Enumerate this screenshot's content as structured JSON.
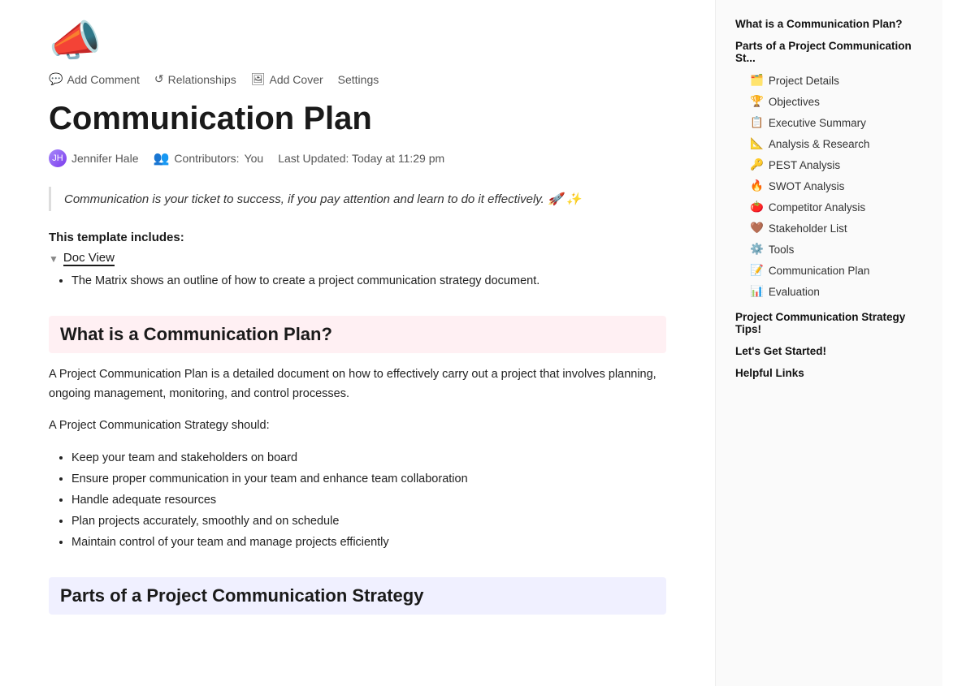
{
  "toolbar": {
    "add_comment_label": "Add Comment",
    "relationships_label": "Relationships",
    "add_cover_label": "Add Cover",
    "settings_label": "Settings"
  },
  "page": {
    "icon": "📣",
    "title": "Communication Plan",
    "author": "Jennifer Hale",
    "contributors_label": "Contributors:",
    "contributors_value": "You",
    "last_updated_label": "Last Updated:",
    "last_updated_value": "Today at 11:29 pm",
    "quote": "Communication is your ticket to success, if you pay attention and learn to do it effectively. 🚀 ✨",
    "template_includes_label": "This template includes:",
    "toggle_label": "Doc View",
    "bullet_text": "The Matrix shows an outline of how to create a project communication strategy document."
  },
  "sections": [
    {
      "id": "what-is",
      "heading": "What is a Communication Plan?",
      "style": "pink",
      "body": "A Project Communication Plan is a detailed document on how to effectively carry out a project that involves planning, ongoing management, monitoring, and control processes.",
      "subtext": "A Project Communication Strategy should:",
      "bullets": [
        "Keep your team and stakeholders on board",
        "Ensure proper communication in your team and enhance team collaboration",
        "Handle adequate resources",
        "Plan projects accurately, smoothly and on schedule",
        "Maintain control of your team and manage projects efficiently"
      ]
    },
    {
      "id": "parts-of",
      "heading": "Parts of a Project Communication Strategy",
      "style": "lavender",
      "body": "",
      "subtext": "",
      "bullets": []
    }
  ],
  "sidebar": {
    "items_main": [
      {
        "label": "What is a Communication Plan?",
        "emoji": ""
      },
      {
        "label": "Parts of a Project Communication St...",
        "emoji": ""
      }
    ],
    "items_sub": [
      {
        "label": "Project Details",
        "emoji": "🗂️"
      },
      {
        "label": "Objectives",
        "emoji": "🏆"
      },
      {
        "label": "Executive Summary",
        "emoji": "📋"
      },
      {
        "label": "Analysis & Research",
        "emoji": "📐"
      },
      {
        "label": "PEST Analysis",
        "emoji": "🔑"
      },
      {
        "label": "SWOT Analysis",
        "emoji": "🔥"
      },
      {
        "label": "Competitor Analysis",
        "emoji": "🍅"
      },
      {
        "label": "Stakeholder List",
        "emoji": "🤎"
      },
      {
        "label": "Tools",
        "emoji": "⚙️"
      },
      {
        "label": "Communication Plan",
        "emoji": "📝"
      },
      {
        "label": "Evaluation",
        "emoji": "📊"
      }
    ],
    "items_bottom": [
      {
        "label": "Project Communication Strategy Tips!",
        "emoji": ""
      },
      {
        "label": "Let's Get Started!",
        "emoji": ""
      },
      {
        "label": "Helpful Links",
        "emoji": ""
      }
    ]
  }
}
